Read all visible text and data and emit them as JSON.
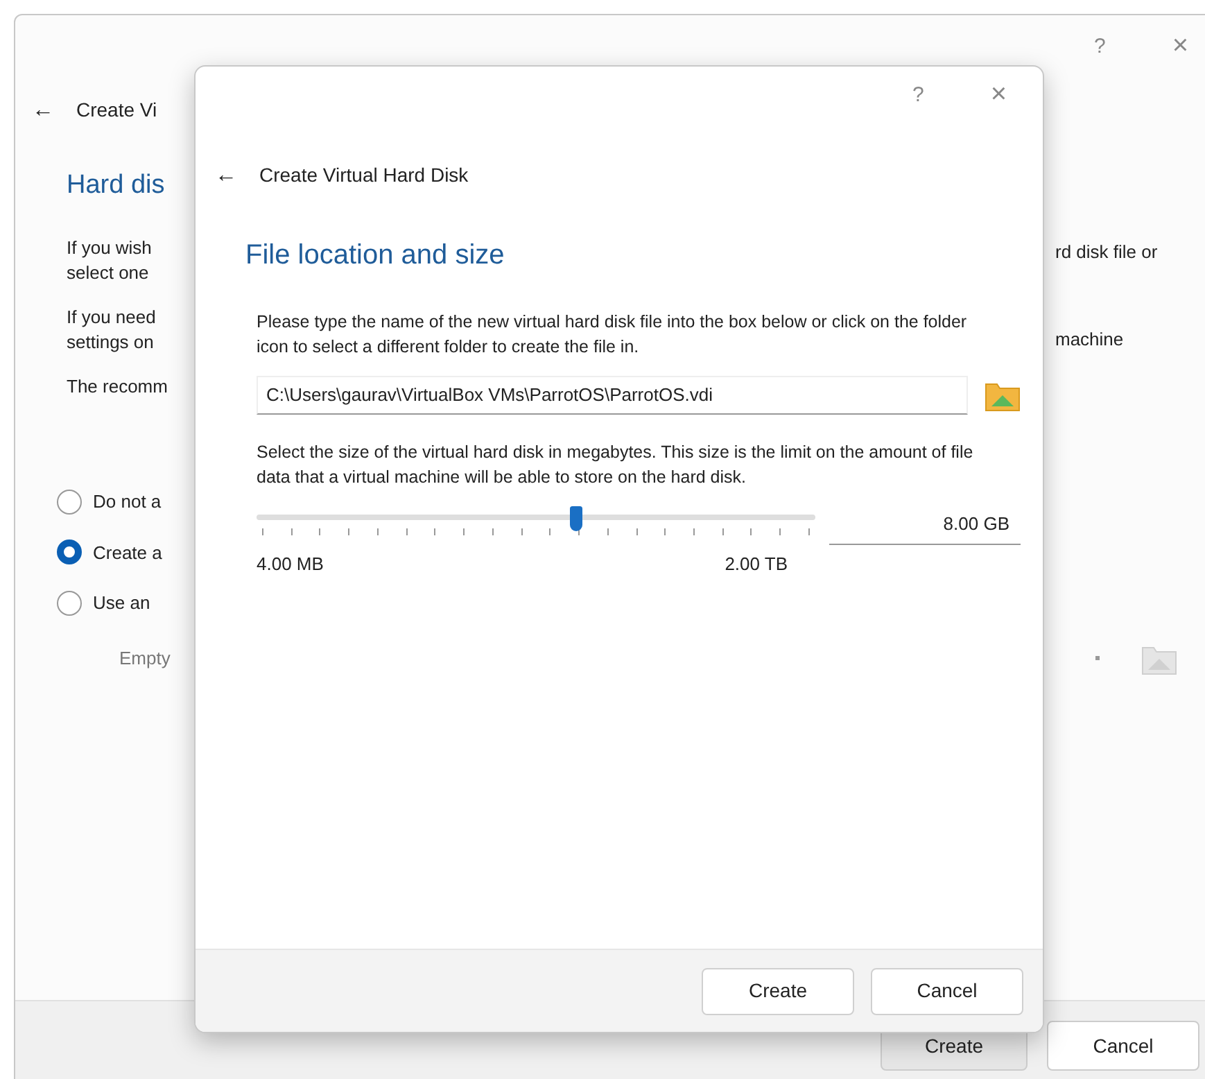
{
  "background_window": {
    "help": "?",
    "close": "×",
    "back": "←",
    "title": "Create Vi",
    "heading": "Hard dis",
    "paragraphs_left": [
      "If you wish\nselect one",
      "If you need\nsettings on",
      "The recomm"
    ],
    "paragraphs_right": [
      "rd disk file or",
      "machine"
    ],
    "options": [
      {
        "label": "Do not a",
        "selected": false
      },
      {
        "label": "Create a",
        "selected": true
      },
      {
        "label": "Use an",
        "selected": false
      }
    ],
    "existing_file": "Empty",
    "buttons": [
      "Create",
      "Cancel"
    ]
  },
  "dialog": {
    "help": "?",
    "close": "×",
    "back": "←",
    "title": "Create Virtual Hard Disk",
    "heading": "File location and size",
    "location_text": "Please type the name of the new virtual hard disk file into the box below or click on the folder icon to select a different folder to create the file in.",
    "file_path": "C:\\Users\\gaurav\\VirtualBox VMs\\ParrotOS\\ParrotOS.vdi",
    "size_text": "Select the size of the virtual hard disk in megabytes. This size is the limit on the amount of file data that a virtual machine will be able to store on the hard disk.",
    "size_slider": {
      "level": 0.57,
      "min_label": "4.00 MB",
      "max_label": "2.00 TB"
    },
    "size_value": "8.00 GB",
    "buttons": [
      "Create",
      "Cancel"
    ]
  }
}
